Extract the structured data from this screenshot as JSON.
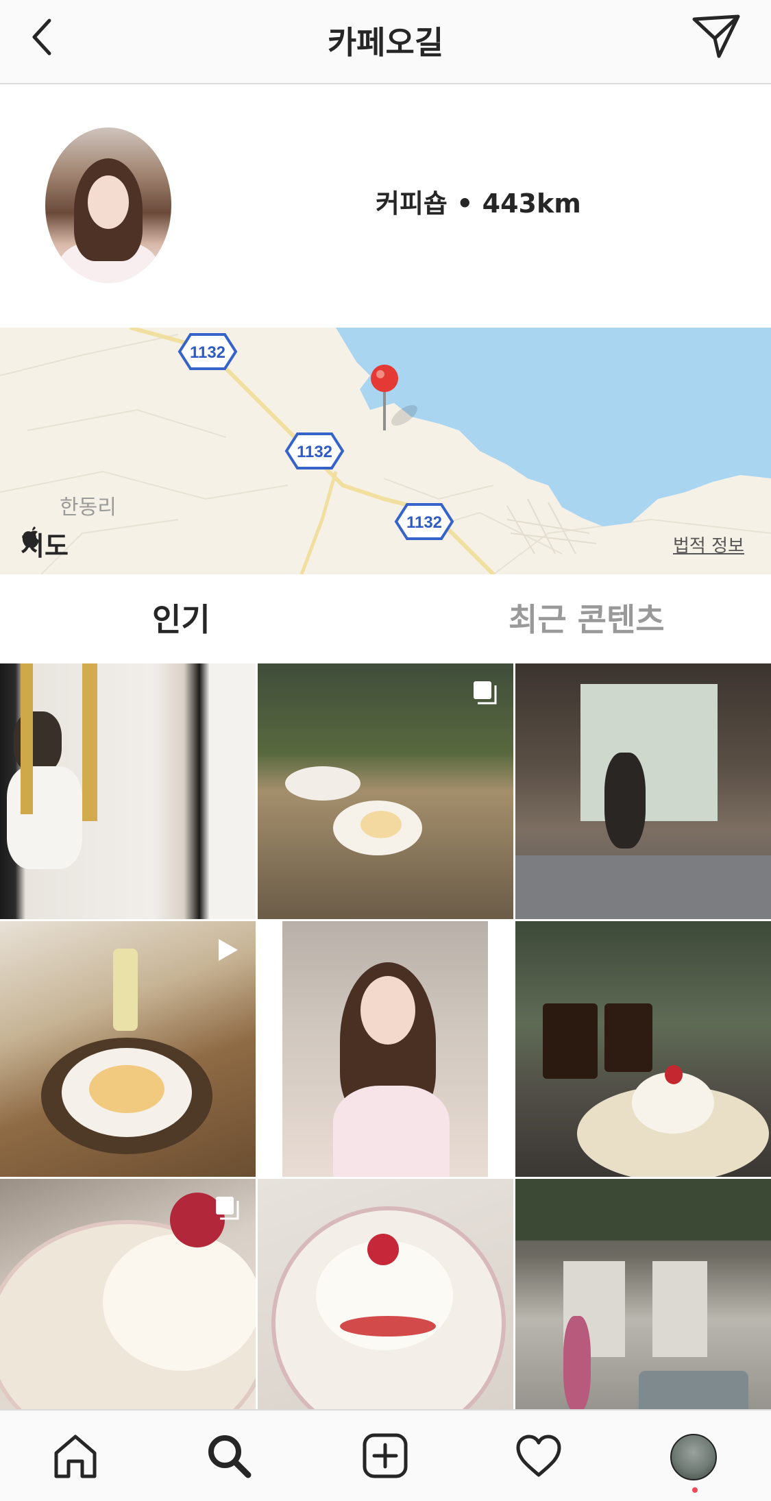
{
  "header": {
    "title": "카페오길",
    "back_icon": "chevron-left-icon",
    "send_icon": "paper-plane-icon"
  },
  "profile": {
    "category": "커피숍",
    "separator": "•",
    "distance": "443km"
  },
  "map": {
    "road_number": "1132",
    "town_label": "한동리",
    "brand_label": "지도",
    "legal_label": "법적 정보",
    "pin_color": "#e53935",
    "sea_color": "#a9d5f1"
  },
  "tabs": {
    "popular": "인기",
    "recent": "최근 콘텐츠"
  },
  "grid": {
    "posts": [
      {
        "subject": "mirror selfie with gold cutlery",
        "badge": "none"
      },
      {
        "subject": "souffle pancake table",
        "badge": "carousel-icon"
      },
      {
        "subject": "woman by window",
        "badge": "none"
      },
      {
        "subject": "fruit plate and drink",
        "badge": "video-icon"
      },
      {
        "subject": "portrait",
        "badge": "none"
      },
      {
        "subject": "iced coffee and pancake",
        "badge": "none"
      },
      {
        "subject": "strawberry pancake close-up",
        "badge": "carousel-icon"
      },
      {
        "subject": "pancake on ornate plate",
        "badge": "none"
      },
      {
        "subject": "cafe interior with plants",
        "badge": "none"
      }
    ]
  },
  "nav": {
    "items": [
      "home-icon",
      "search-icon",
      "add-post-icon",
      "activity-heart-icon",
      "profile-avatar-icon"
    ],
    "notification_color": "#ed4956"
  }
}
